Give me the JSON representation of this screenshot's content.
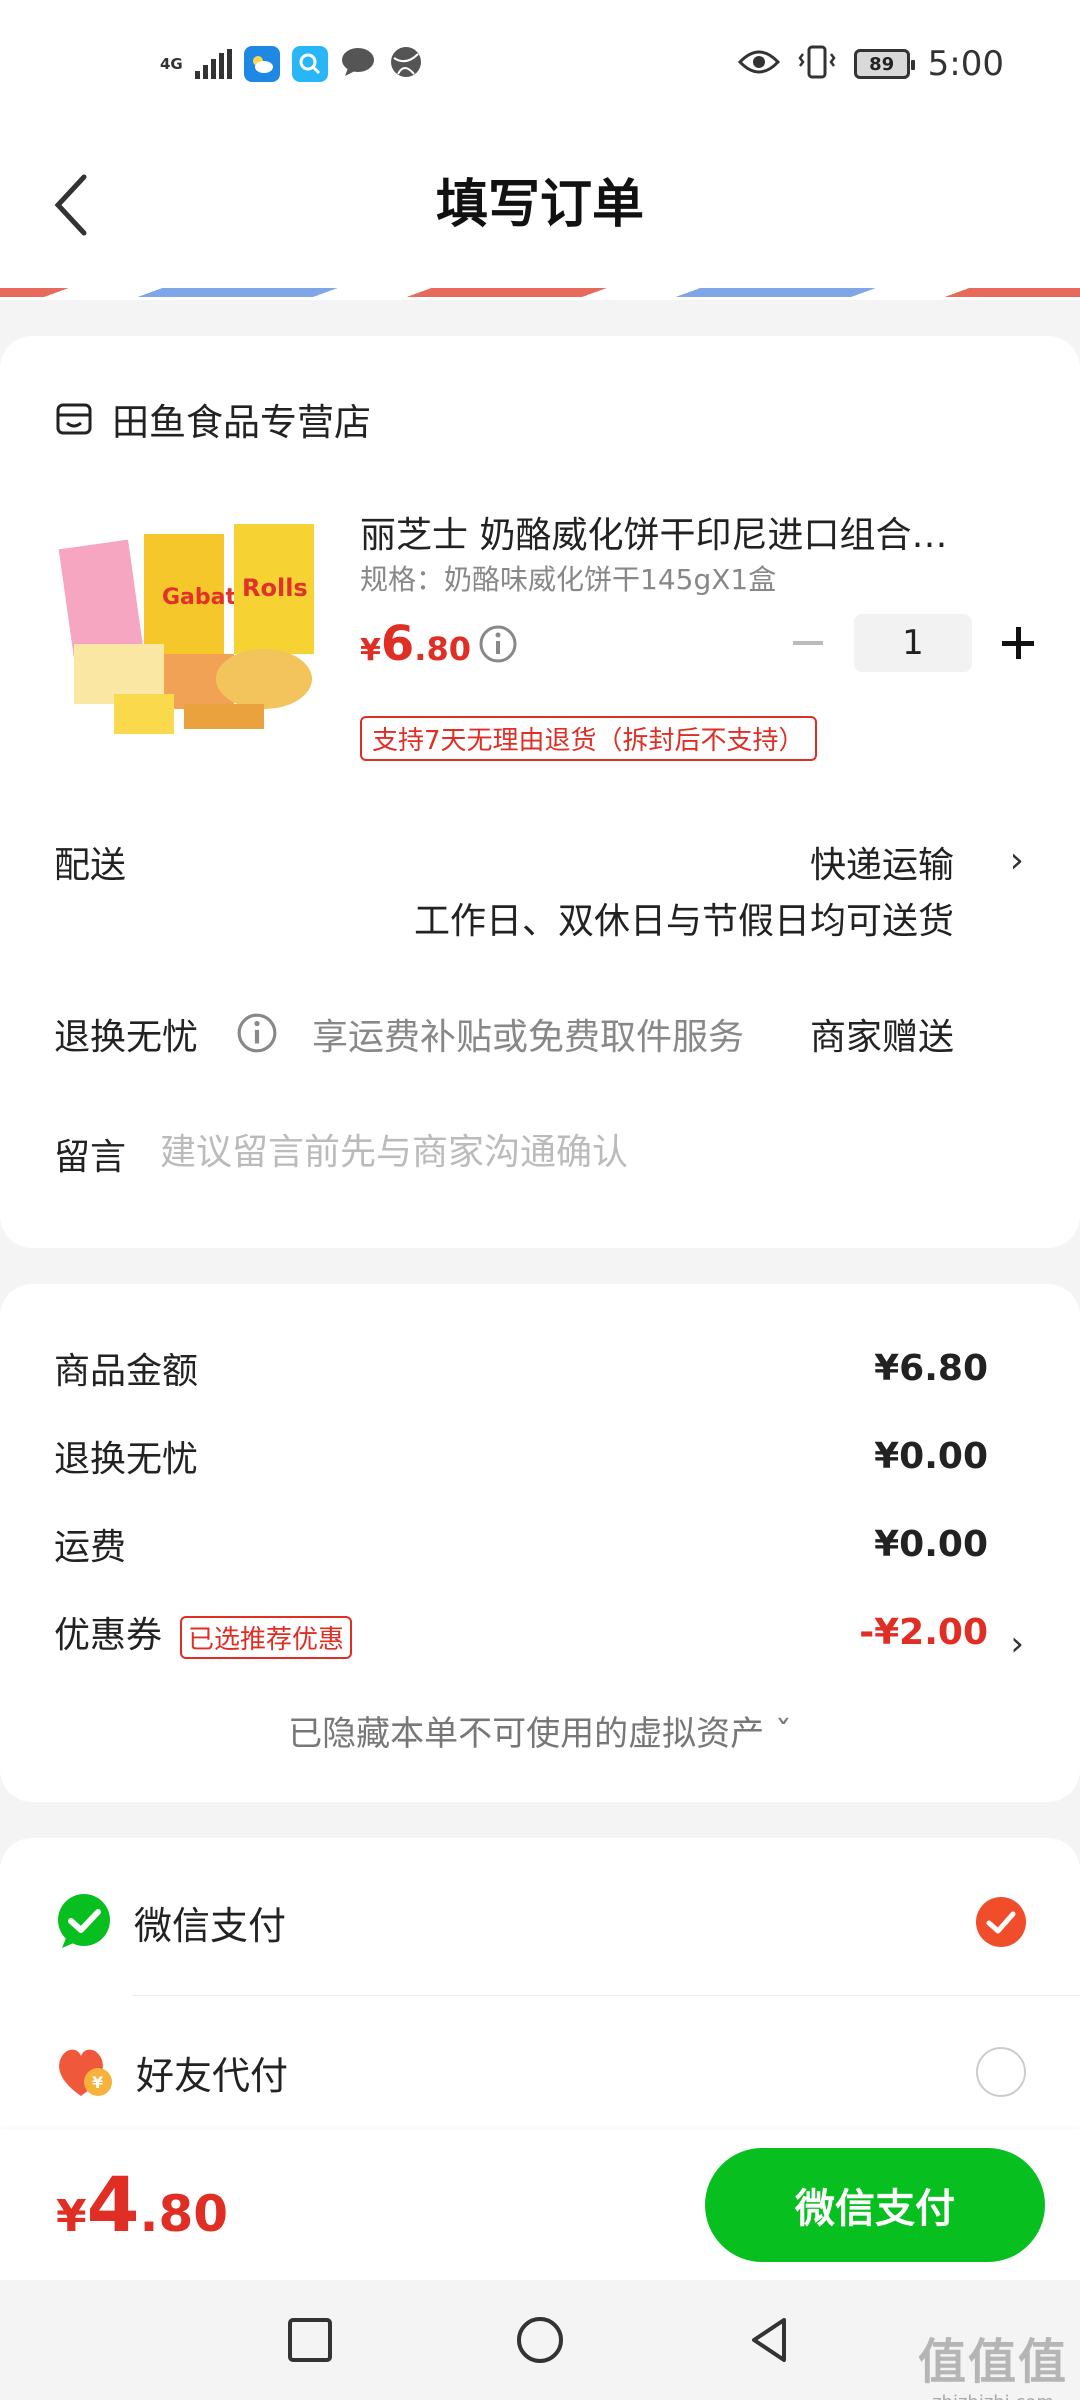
{
  "status_bar": {
    "network": "4G",
    "battery": "89",
    "time": "5:00"
  },
  "header": {
    "title": "填写订单"
  },
  "store": {
    "name": "田鱼食品专营店"
  },
  "product": {
    "title": "丽芝士 奶酪威化饼干印尼进口组合…",
    "spec": "规格：奶酪味威化饼干145gX1盒",
    "price_currency": "¥",
    "price_int": "6",
    "price_dec": ".80",
    "quantity": "1",
    "return_policy": "支持7天无理由退货（拆封后不支持）"
  },
  "delivery": {
    "label": "配送",
    "method": "快递运输",
    "desc": "工作日、双休日与节假日均可送货",
    "arrow": "›"
  },
  "worry_free": {
    "label": "退换无忧",
    "desc": "享运费补贴或免费取件服务",
    "gift": "商家赠送"
  },
  "message": {
    "label": "留言",
    "placeholder": "建议留言前先与商家沟通确认"
  },
  "price_summary": {
    "goods_label": "商品金额",
    "goods_amount": "¥6.80",
    "worry_label": "退换无忧",
    "worry_amount": "¥0.00",
    "shipping_label": "运费",
    "shipping_amount": "¥0.00",
    "coupon_label": "优惠券",
    "coupon_badge": "已选推荐优惠",
    "coupon_amount": "-¥2.00",
    "coupon_arrow": "›",
    "hidden_assets": "已隐藏本单不可使用的虚拟资产 ˇ"
  },
  "payment": {
    "wechat_label": "微信支付",
    "friend_label": "好友代付",
    "selected": "wechat"
  },
  "bottom_bar": {
    "total_currency": "¥",
    "total_int": "4",
    "total_dec": ".80",
    "pay_button": "微信支付"
  },
  "watermark": {
    "big": "值值值",
    "small": "zhizhizhi.com"
  },
  "colors": {
    "accent_red": "#e02e24",
    "wechat_green": "#07c020",
    "check_orange": "#f04d2a"
  }
}
